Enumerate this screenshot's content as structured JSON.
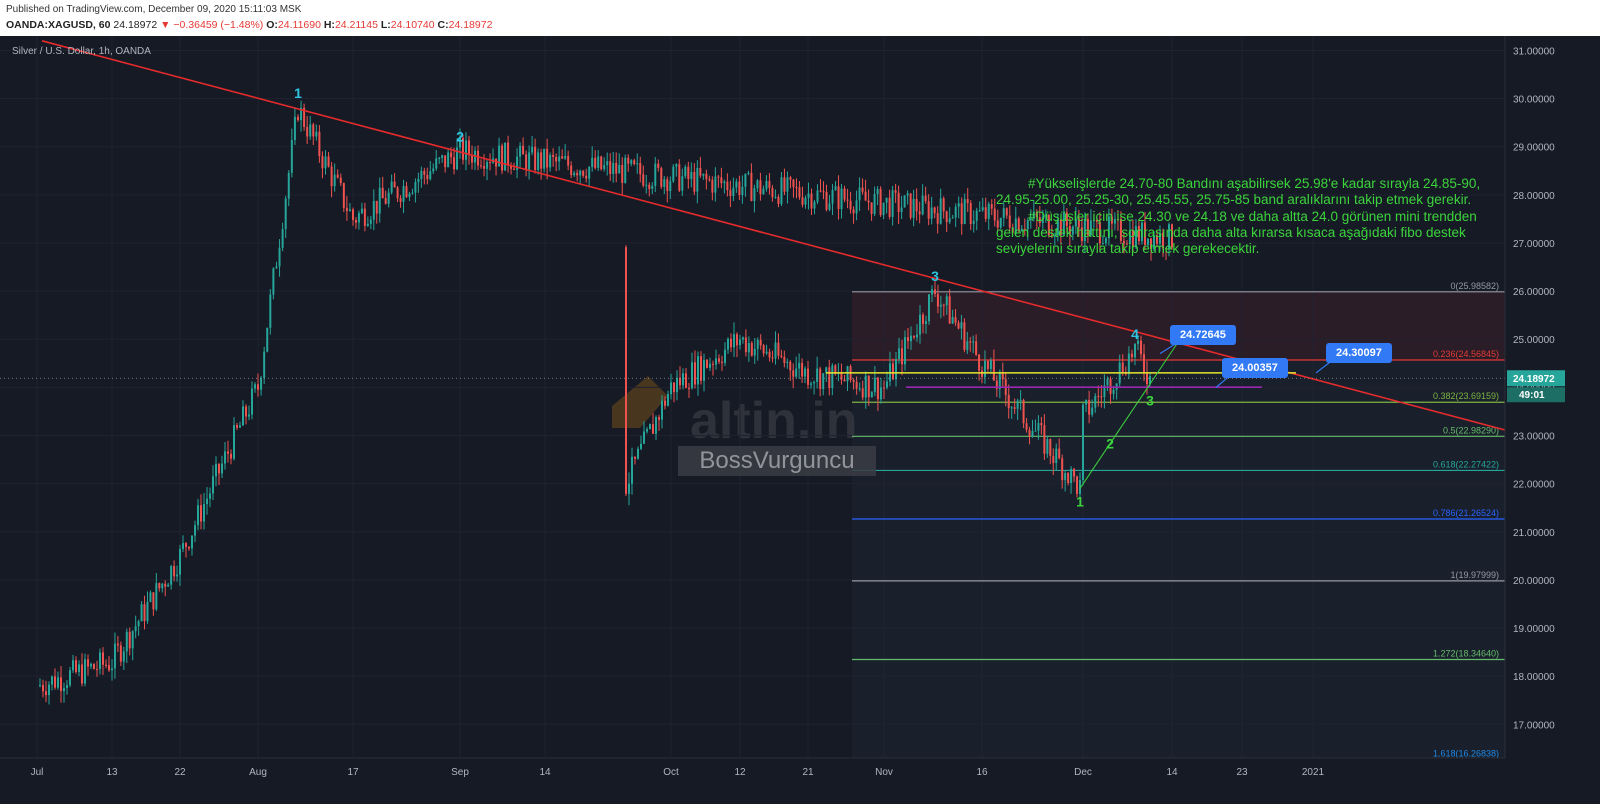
{
  "header": {
    "published": "Published on TradingView.com, December 09, 2020 15:11:03 MSK",
    "symbol": "OANDA:XAGUSD, 60",
    "last": "24.18972",
    "change": "−0.36459 (−1.48%)",
    "o_label": "O:",
    "o": "24.11690",
    "h_label": "H:",
    "h": "24.21145",
    "l_label": "L:",
    "l": "24.10740",
    "c_label": "C:",
    "c": "24.18972"
  },
  "legend": {
    "title": "Silver / U.S. Dollar, 1h, OANDA"
  },
  "annotation": {
    "line1": "#Yükselişlerde 24.70-80 Bandını aşabilirsek 25.98'e kadar sırayla 24.85-90, 24.95-25.00, 25.25-30, 25.45.55, 25.75-85 band aralıklarını takip etmek gerekir.",
    "line2": "#Düşüşler için ise 24.30 ve 24.18 ve daha altta 24.0 görünen mini trendden gelen destek hattını, sonrasında daha alta kırarsa kısaca aşağıdaki fibo destek seviyelerini sırayla takip etmek gerekecektir."
  },
  "price_tags": {
    "t1": "24.72645",
    "t2": "24.00357",
    "t3": "24.30097"
  },
  "current_price": {
    "value": "24.18972",
    "countdown": "49:01"
  },
  "watermark": {
    "brand": "altin.in",
    "author": "BossVurguncu"
  },
  "colors": {
    "background": "#161a25",
    "trendline": "#e52b2b",
    "up": "#26a69a",
    "down": "#ef5350",
    "text_green": "#3cd43c",
    "tag_blue": "#3179f5"
  },
  "chart_data": {
    "type": "candlestick",
    "title": "Silver / U.S. Dollar, 1h, OANDA",
    "ylim": [
      16.3,
      31.3
    ],
    "y_ticks": [
      "31.00000",
      "30.00000",
      "29.00000",
      "28.00000",
      "27.00000",
      "26.00000",
      "25.00000",
      "24.00000",
      "23.00000",
      "22.00000",
      "21.00000",
      "20.00000",
      "19.00000",
      "18.00000",
      "17.00000"
    ],
    "x_ticks": [
      "Jul",
      "13",
      "22",
      "Aug",
      "17",
      "Sep",
      "14",
      "Oct",
      "12",
      "21",
      "Nov",
      "16",
      "Dec",
      "14",
      "23",
      "2021"
    ],
    "price_path": [
      {
        "x": "Jul",
        "y": 17.8
      },
      {
        "x": "13",
        "y": 18.3
      },
      {
        "x": "22",
        "y": 20.5
      },
      {
        "x": "Aug",
        "y": 24.0
      },
      {
        "x": "Aug 7",
        "y": 29.8
      },
      {
        "x": "17",
        "y": 27.5
      },
      {
        "x": "Sep",
        "y": 28.9
      },
      {
        "x": "14",
        "y": 27.1
      },
      {
        "x": "Sep 24",
        "y": 22.0
      },
      {
        "x": "Oct",
        "y": 24.0
      },
      {
        "x": "12",
        "y": 25.0
      },
      {
        "x": "21",
        "y": 24.3
      },
      {
        "x": "Nov",
        "y": 24.0
      },
      {
        "x": "Nov 9",
        "y": 26.0
      },
      {
        "x": "16",
        "y": 24.5
      },
      {
        "x": "Nov 30",
        "y": 21.9
      },
      {
        "x": "Dec",
        "y": 23.4
      },
      {
        "x": "Dec 7",
        "y": 24.8
      },
      {
        "x": "Dec 9",
        "y": 24.19
      }
    ],
    "trendline": {
      "from": {
        "x": "Jul",
        "y": 31.2
      },
      "to": {
        "x": "2021",
        "y": 22.6
      }
    },
    "fibonacci": [
      {
        "label": "0(25.98582)",
        "value": 25.98582
      },
      {
        "label": "0.236(24.56845)",
        "value": 24.56845
      },
      {
        "label": "0.382(23.69159)",
        "value": 23.69159
      },
      {
        "label": "0.5(22.98290)",
        "value": 22.9829
      },
      {
        "label": "0.618(22.27422)",
        "value": 22.27422
      },
      {
        "label": "0.786(21.26524)",
        "value": 21.26524
      },
      {
        "label": "1(19.97999)",
        "value": 19.97999
      },
      {
        "label": "1.272(18.34640)",
        "value": 18.3464
      },
      {
        "label": "1.618(16.26838)",
        "value": 16.26838
      }
    ],
    "horizontal_levels": [
      {
        "value": 24.30097,
        "color": "#e6e62e"
      },
      {
        "value": 24.00357,
        "color": "#9c27b0"
      }
    ],
    "wave_labels": [
      {
        "text": "1",
        "x": "Aug 7",
        "y": 29.8,
        "color": "#2ec4e0"
      },
      {
        "text": "2",
        "x": "Sep",
        "y": 28.9,
        "color": "#2ec4e0"
      },
      {
        "text": "3",
        "x": "Nov 9",
        "y": 26.0,
        "color": "#2ec4e0"
      },
      {
        "text": "4",
        "x": "Dec 7",
        "y": 24.8,
        "color": "#2ec4e0"
      },
      {
        "text": "1",
        "x": "Nov 30",
        "y": 21.9,
        "color": "#3cd43c"
      },
      {
        "text": "2",
        "x": "Dec 3",
        "y": 23.1,
        "color": "#3cd43c"
      },
      {
        "text": "3",
        "x": "Dec 9",
        "y": 24.0,
        "color": "#3cd43c"
      }
    ]
  }
}
